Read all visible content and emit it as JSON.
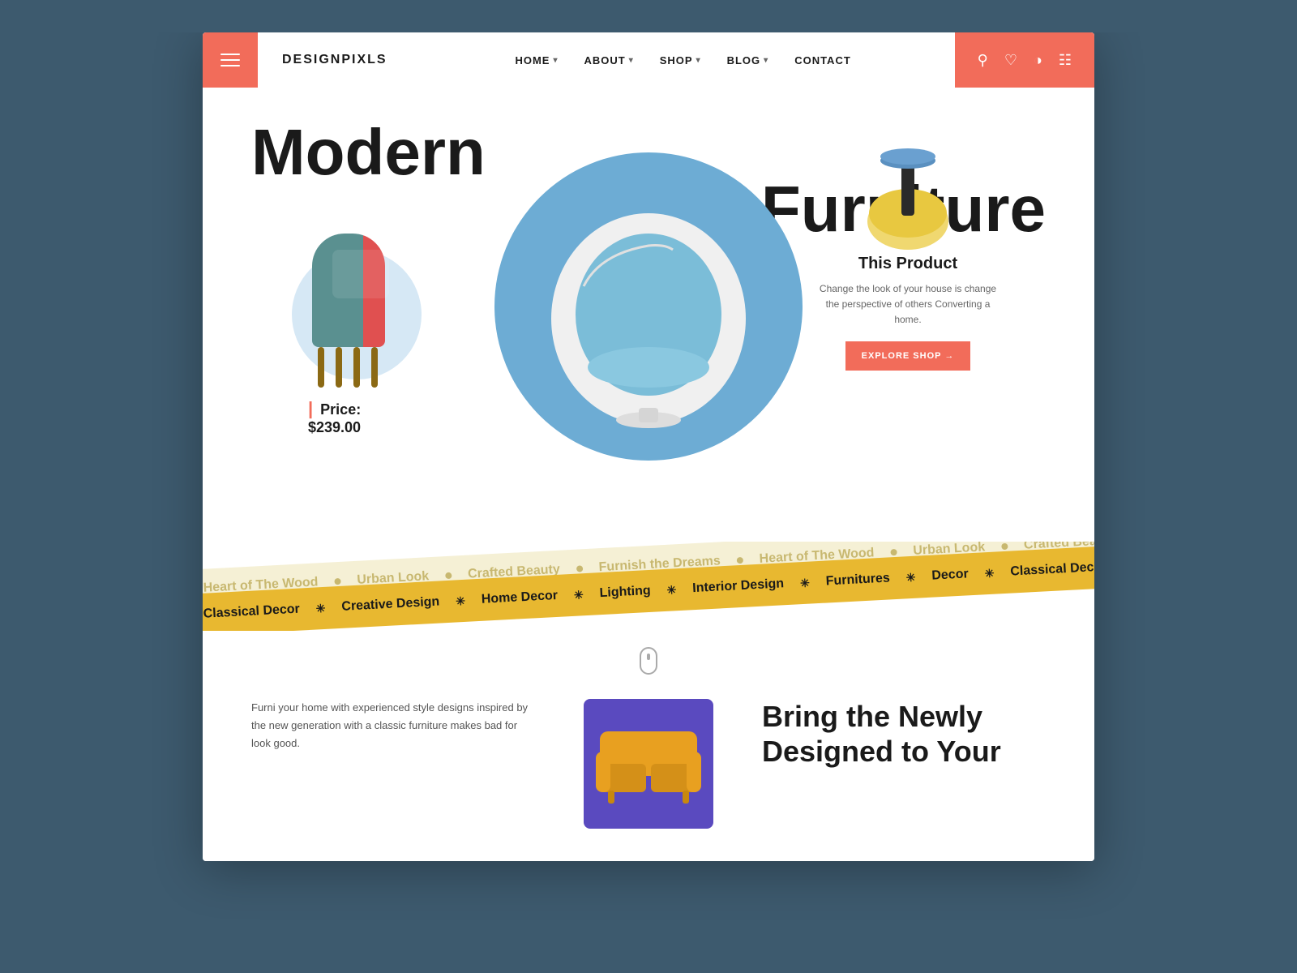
{
  "brand": {
    "name": "DESIGNPIXLS"
  },
  "header": {
    "hamburger_label": "Menu",
    "nav_items": [
      {
        "label": "HOME",
        "has_dropdown": true
      },
      {
        "label": "ABOUT",
        "has_dropdown": true
      },
      {
        "label": "SHOP",
        "has_dropdown": true
      },
      {
        "label": "BLOG",
        "has_dropdown": true
      },
      {
        "label": "CONTACT",
        "has_dropdown": false
      }
    ]
  },
  "hero": {
    "title_top": "Modern",
    "title_bottom": "Furniture",
    "price_label": "Price: $239.00",
    "product_title": "This Product",
    "product_desc": "Change the look of your house is change the perspective of others Converting a home.",
    "explore_btn": "EXPLORE SHOP →"
  },
  "ticker": {
    "items_light": [
      "Heart of The Wood",
      "Urban Look",
      "Crafted Beauty",
      "Furnish the Dreams"
    ],
    "items_dark": [
      "Classical Decor",
      "Creative Design",
      "Home Decor",
      "Lighting",
      "Interior Design",
      "Furnitures"
    ]
  },
  "bottom": {
    "body_text": "Furni your home with experienced style designs inspired by the new generation with a classic furniture makes bad for look good.",
    "heading_line1": "Bring the Newly",
    "heading_line2": "Designed to Your"
  },
  "colors": {
    "accent": "#f26c5a",
    "blue_circle": "#6dacd4",
    "ticker_gold": "#e8b830",
    "ticker_light": "#f5f0d5",
    "dark_text": "#1a1a1a"
  }
}
